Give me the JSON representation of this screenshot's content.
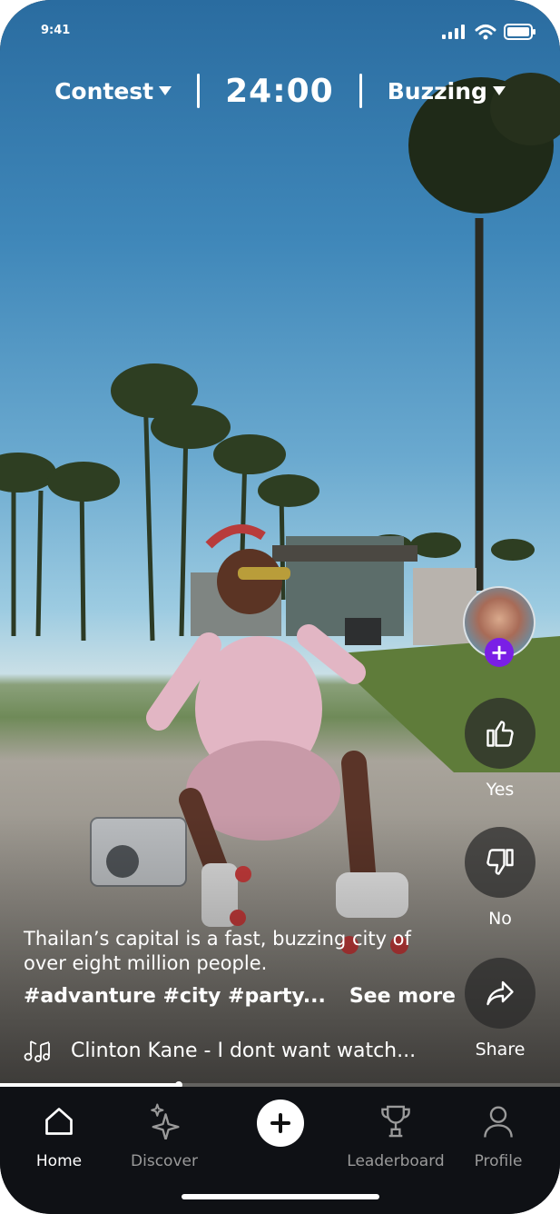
{
  "status_bar": {
    "time": "9:41"
  },
  "header": {
    "left_label": "Contest",
    "timer": "24:00",
    "right_label": "Buzzing"
  },
  "actions": {
    "yes_label": "Yes",
    "no_label": "No",
    "share_label": "Share"
  },
  "post": {
    "caption": "Thailan’s capital is a fast, buzzing city of over eight million people.",
    "hashtags": "#advanture #city #party...",
    "see_more": "See more",
    "music": "Clinton Kane - I dont want watch...",
    "progress": 0.32
  },
  "tabs": [
    {
      "label": "Home",
      "icon": "home-icon",
      "active": true
    },
    {
      "label": "Discover",
      "icon": "sparkle-icon",
      "active": false
    },
    {
      "label": "",
      "icon": "plus-icon",
      "active": false
    },
    {
      "label": "Leaderboard",
      "icon": "trophy-icon",
      "active": false
    },
    {
      "label": "Profile",
      "icon": "profile-icon",
      "active": false
    }
  ],
  "colors": {
    "accent": "#7a1fe6",
    "tabbar_bg": "#0f1115"
  }
}
